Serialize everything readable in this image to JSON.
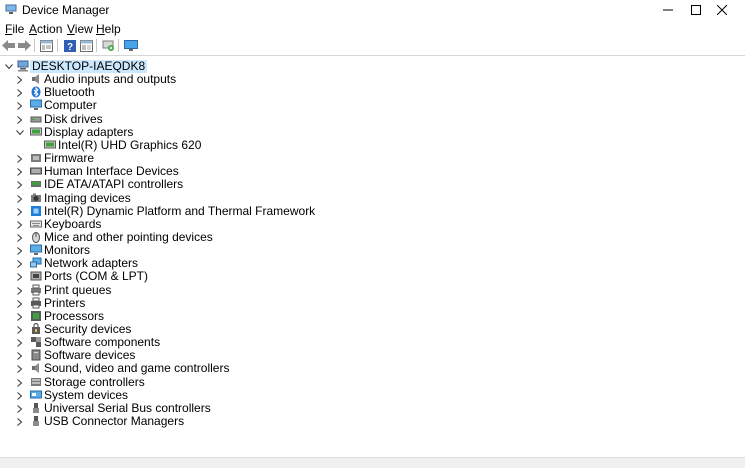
{
  "window": {
    "title": "Device Manager"
  },
  "menu": [
    "File",
    "Action",
    "View",
    "Help"
  ],
  "menu_underline": [
    "F",
    "A",
    "V",
    "H"
  ],
  "toolbar": [
    "back-icon",
    "forward-icon",
    "properties-icon",
    "help-icon",
    "update-driver-icon",
    "scan-hardware-icon",
    "monitor-icon"
  ],
  "tree": {
    "root": "DESKTOP-IAEQDK8",
    "items": [
      {
        "label": "Audio inputs and outputs",
        "icon": "speaker-icon",
        "expanded": false
      },
      {
        "label": "Bluetooth",
        "icon": "bluetooth-icon",
        "expanded": false
      },
      {
        "label": "Computer",
        "icon": "computer-icon",
        "expanded": false
      },
      {
        "label": "Disk drives",
        "icon": "disk-icon",
        "expanded": false
      },
      {
        "label": "Display adapters",
        "icon": "display-adapter-icon",
        "expanded": true,
        "children": [
          "Intel(R) UHD Graphics 620"
        ]
      },
      {
        "label": "Firmware",
        "icon": "firmware-icon",
        "expanded": false
      },
      {
        "label": "Human Interface Devices",
        "icon": "hid-icon",
        "expanded": false
      },
      {
        "label": "IDE ATA/ATAPI controllers",
        "icon": "ide-icon",
        "expanded": false
      },
      {
        "label": "Imaging devices",
        "icon": "camera-icon",
        "expanded": false
      },
      {
        "label": "Intel(R) Dynamic Platform and Thermal Framework",
        "icon": "chip-icon",
        "expanded": false
      },
      {
        "label": "Keyboards",
        "icon": "keyboard-icon",
        "expanded": false
      },
      {
        "label": "Mice and other pointing devices",
        "icon": "mouse-icon",
        "expanded": false
      },
      {
        "label": "Monitors",
        "icon": "monitor-icon",
        "expanded": false
      },
      {
        "label": "Network adapters",
        "icon": "network-icon",
        "expanded": false
      },
      {
        "label": "Ports (COM & LPT)",
        "icon": "port-icon",
        "expanded": false
      },
      {
        "label": "Print queues",
        "icon": "print-queue-icon",
        "expanded": false
      },
      {
        "label": "Printers",
        "icon": "printer-icon",
        "expanded": false
      },
      {
        "label": "Processors",
        "icon": "processor-icon",
        "expanded": false
      },
      {
        "label": "Security devices",
        "icon": "security-icon",
        "expanded": false
      },
      {
        "label": "Software components",
        "icon": "software-component-icon",
        "expanded": false
      },
      {
        "label": "Software devices",
        "icon": "software-device-icon",
        "expanded": false
      },
      {
        "label": "Sound, video and game controllers",
        "icon": "sound-icon",
        "expanded": false
      },
      {
        "label": "Storage controllers",
        "icon": "storage-icon",
        "expanded": false
      },
      {
        "label": "System devices",
        "icon": "system-icon",
        "expanded": false
      },
      {
        "label": "Universal Serial Bus controllers",
        "icon": "usb-icon",
        "expanded": false
      },
      {
        "label": "USB Connector Managers",
        "icon": "usb-connector-icon",
        "expanded": false
      }
    ]
  },
  "colors": {
    "selection": "#cce8ff",
    "accent": "#1e7fd6"
  }
}
